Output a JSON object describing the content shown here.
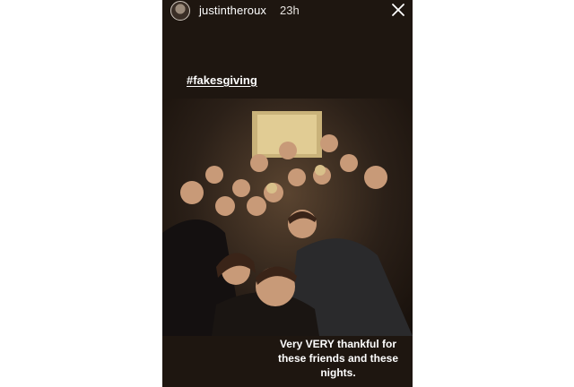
{
  "story": {
    "username": "justintheroux",
    "timestamp": "23h",
    "hashtag": "#fakesgiving",
    "caption": "Very VERY thankful for these friends and these nights.",
    "icons": {
      "avatar": "profile-avatar",
      "close": "close-icon"
    },
    "colors": {
      "background": "#1e1610",
      "text": "#ffffff"
    }
  }
}
